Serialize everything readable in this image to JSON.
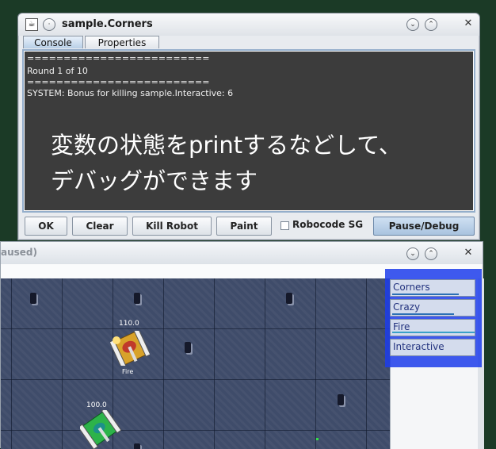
{
  "background_window": {
    "title_fragment": "aused)",
    "robots": [
      {
        "name": "",
        "energy": "110.0",
        "label": "Fire"
      },
      {
        "name": "",
        "energy": "100.0",
        "label": ""
      }
    ],
    "robot_list": [
      {
        "name": "Corners",
        "energy_fraction": 0.8
      },
      {
        "name": "Crazy",
        "energy_fraction": 0.75
      },
      {
        "name": "Fire",
        "energy_fraction": 1.0
      },
      {
        "name": "Interactive",
        "energy_fraction": 0.0
      }
    ]
  },
  "dialog": {
    "title": "sample.Corners",
    "tabs": [
      {
        "label": "Console",
        "active": true
      },
      {
        "label": "Properties",
        "active": false
      }
    ],
    "console_lines": [
      "=========================",
      "Round 1 of 10",
      "=========================",
      "SYSTEM: Bonus for killing sample.Interactive: 6"
    ],
    "overlay_lines": [
      "変数の状態をprintするなどして、",
      "デバッグができます"
    ],
    "buttons": {
      "ok": "OK",
      "clear": "Clear",
      "kill": "Kill Robot",
      "paint": "Paint",
      "sg_label": "Robocode SG",
      "pause": "Pause/Debug"
    },
    "sg_checked": false
  },
  "colors": {
    "desktop": "#1b3a26",
    "arena": "#3f4c6a",
    "console_bg": "#3c3c3c",
    "highlight": "#1c3ceb"
  }
}
